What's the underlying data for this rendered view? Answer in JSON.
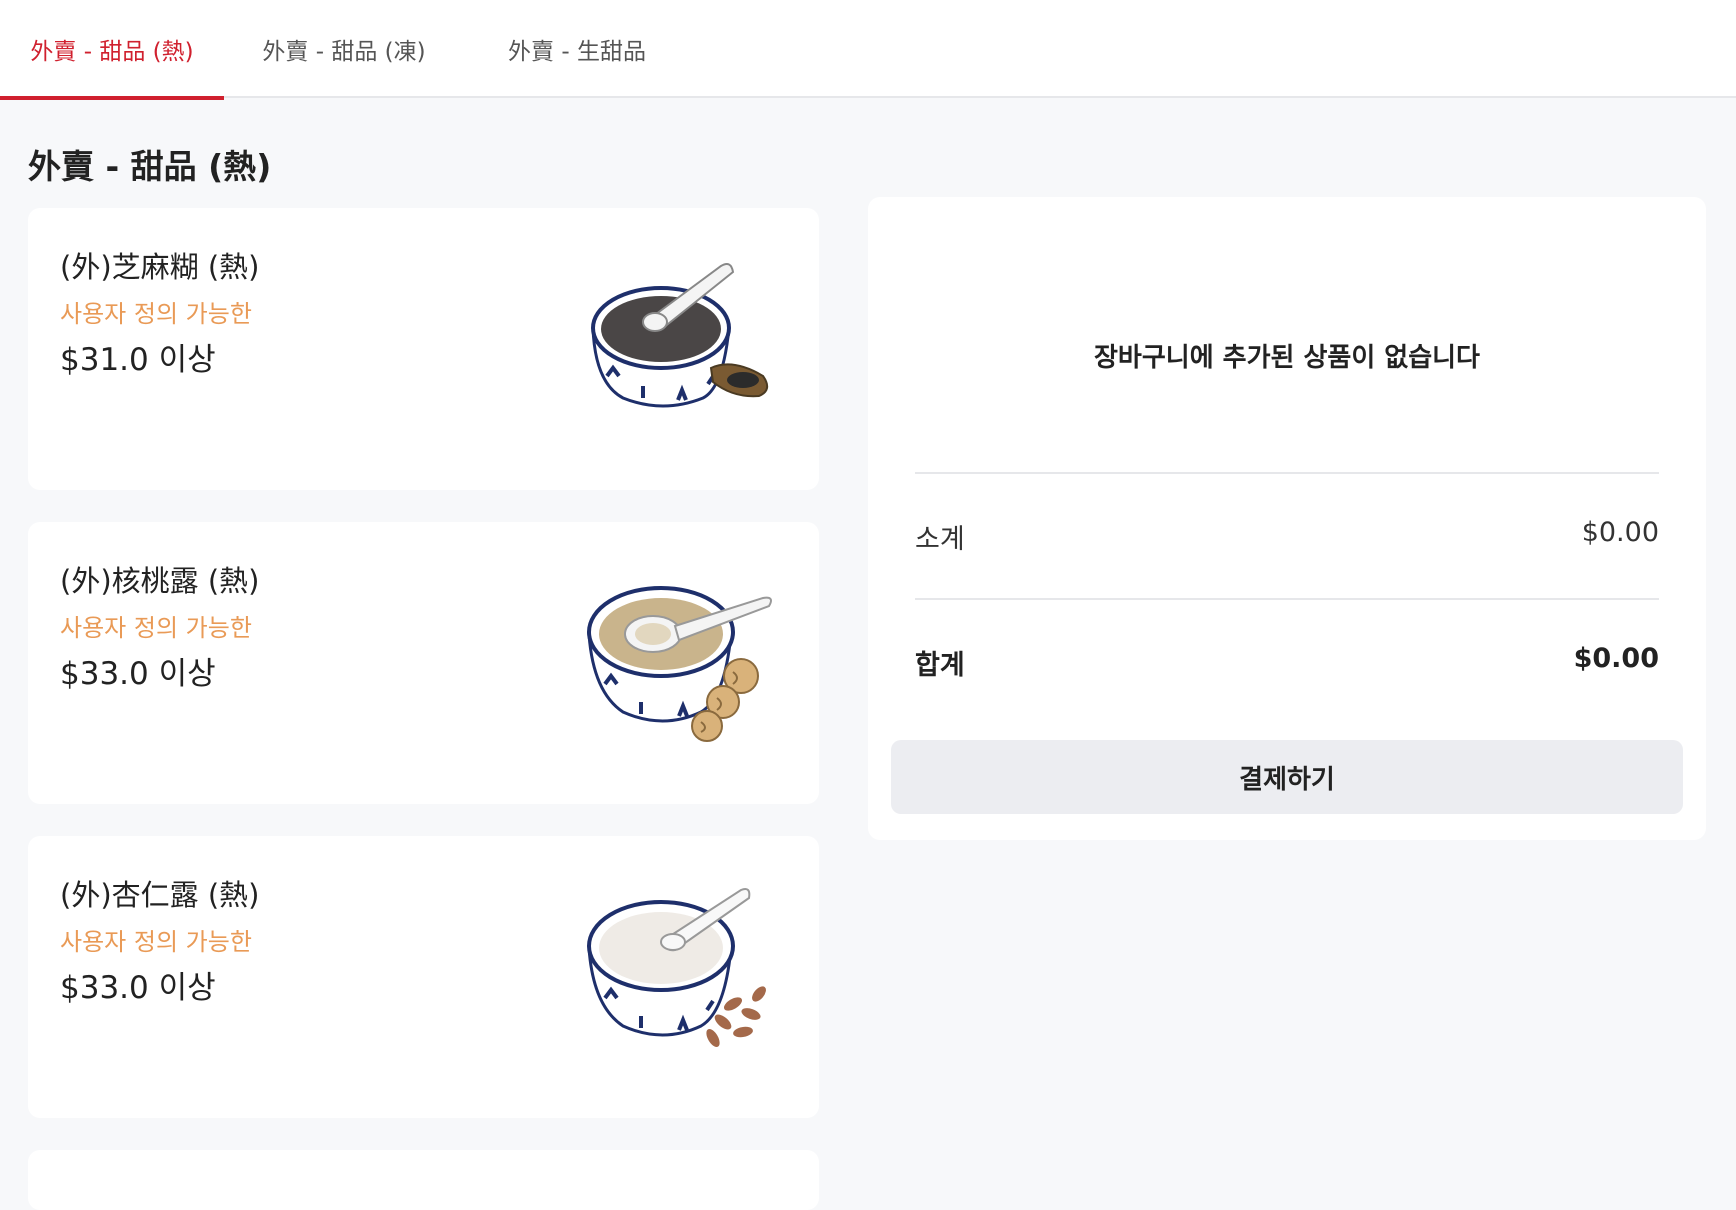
{
  "tabs": [
    {
      "label": "外賣 - 甜品 (熱)",
      "active": true
    },
    {
      "label": "外賣 - 甜品 (凍)",
      "active": false
    },
    {
      "label": "外賣 - 生甜品",
      "active": false
    }
  ],
  "section": {
    "title": "外賣 - 甜品 (熱)"
  },
  "items": [
    {
      "name": "(外)芝麻糊 (熱)",
      "custom": "사용자 정의 가능한",
      "price": "$31.0 이상",
      "image": "black-sesame-soup-bowl-icon"
    },
    {
      "name": "(外)核桃露 (熱)",
      "custom": "사용자 정의 가능한",
      "price": "$33.0 이상",
      "image": "walnut-soup-bowl-icon"
    },
    {
      "name": "(外)杏仁露 (熱)",
      "custom": "사용자 정의 가능한",
      "price": "$33.0 이상",
      "image": "almond-soup-bowl-icon"
    }
  ],
  "cart": {
    "empty_message": "장바구니에 추가된 상품이 없습니다",
    "subtotal_label": "소계",
    "subtotal_value": "$0.00",
    "total_label": "합계",
    "total_value": "$0.00",
    "checkout_label": "결제하기"
  },
  "colors": {
    "accent": "#d0202e",
    "custom": "#e99a56",
    "background": "#f7f8fa"
  }
}
